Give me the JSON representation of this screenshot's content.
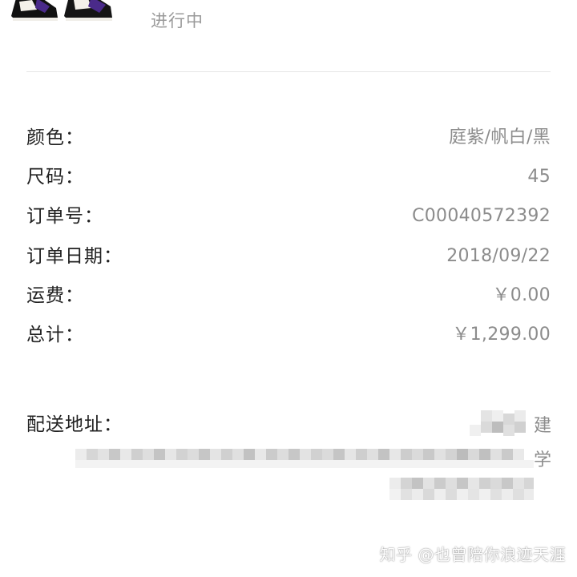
{
  "order": {
    "status": "进行中"
  },
  "details": [
    {
      "label": "颜色：",
      "value": "庭紫/帆白/黑"
    },
    {
      "label": "尺码：",
      "value": "45"
    },
    {
      "label": "订单号：",
      "value": "C00040572392"
    },
    {
      "label": "订单日期：",
      "value": "2018/09/22"
    },
    {
      "label": "运费：",
      "value": "￥0.00"
    },
    {
      "label": "总计：",
      "value": "￥1,299.00"
    }
  ],
  "shipping": {
    "label": "配送地址：",
    "visible_fragments": [
      "建",
      "学"
    ]
  },
  "watermark": "知乎 @也曾陪你浪迹天涯",
  "colors": {
    "text_primary": "#222222",
    "text_secondary": "#8c8c8c",
    "divider": "#e6e6e6",
    "shoe_purple": "#4a2a8a"
  }
}
